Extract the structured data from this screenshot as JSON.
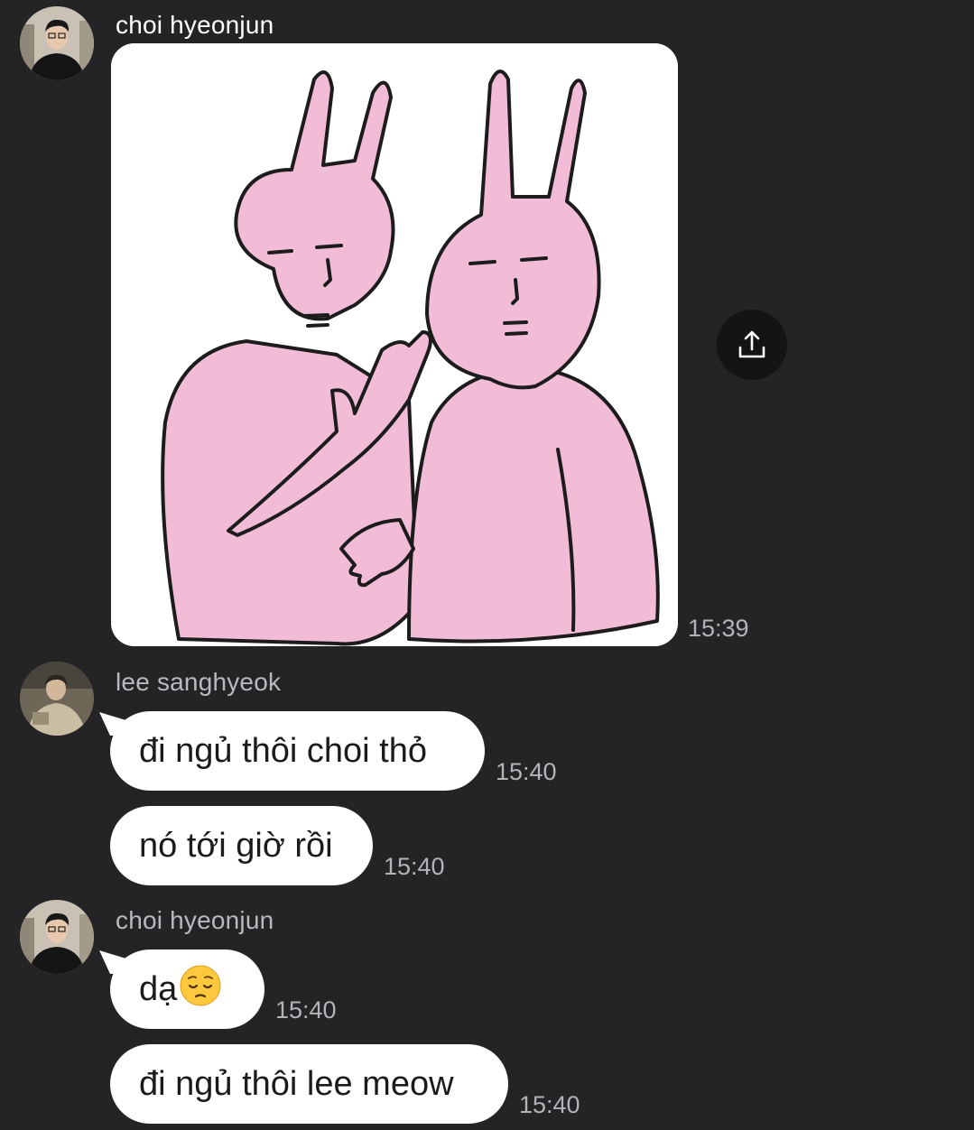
{
  "messages": {
    "group1": {
      "sender": "choi hyeonjun",
      "sticker_time": "15:39"
    },
    "group2": {
      "sender": "lee sanghyeok",
      "msg1": {
        "text": "đi ngủ thôi choi thỏ",
        "time": "15:40"
      },
      "msg2": {
        "text": "nó tới giờ rồi",
        "time": "15:40"
      }
    },
    "group3": {
      "sender": "choi hyeonjun",
      "msg1": {
        "text": "dạ",
        "emoji": "pensive-face",
        "time": "15:40"
      },
      "msg2": {
        "text": "đi ngủ thôi lee meow",
        "time": "15:40"
      }
    }
  },
  "icons": {
    "share": "share-upload-icon"
  },
  "colors": {
    "background": "#242427",
    "bubble": "#ffffff",
    "sticker_pink": "#f2bcd6"
  }
}
